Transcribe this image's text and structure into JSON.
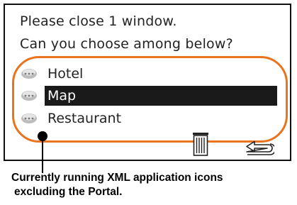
{
  "dialog": {
    "prompt_line_1": "Please close 1 window.",
    "prompt_line_2": "Can you choose among below?"
  },
  "options": [
    {
      "label": "Hotel",
      "icon": "app-icon",
      "selected": false
    },
    {
      "label": "Map",
      "icon": "app-icon",
      "selected": true
    },
    {
      "label": "Restaurant",
      "icon": "app-icon",
      "selected": false
    }
  ],
  "toolbar": {
    "delete_icon": "trash-icon",
    "back_icon": "return-arrow-icon"
  },
  "annotation": {
    "caption_line_1": "Currently running XML application icons",
    "caption_line_2": "excluding the Portal.",
    "highlight_color": "#e8741e"
  },
  "colors": {
    "selection_background": "#1a1a1a",
    "selection_text": "#ffffff"
  }
}
